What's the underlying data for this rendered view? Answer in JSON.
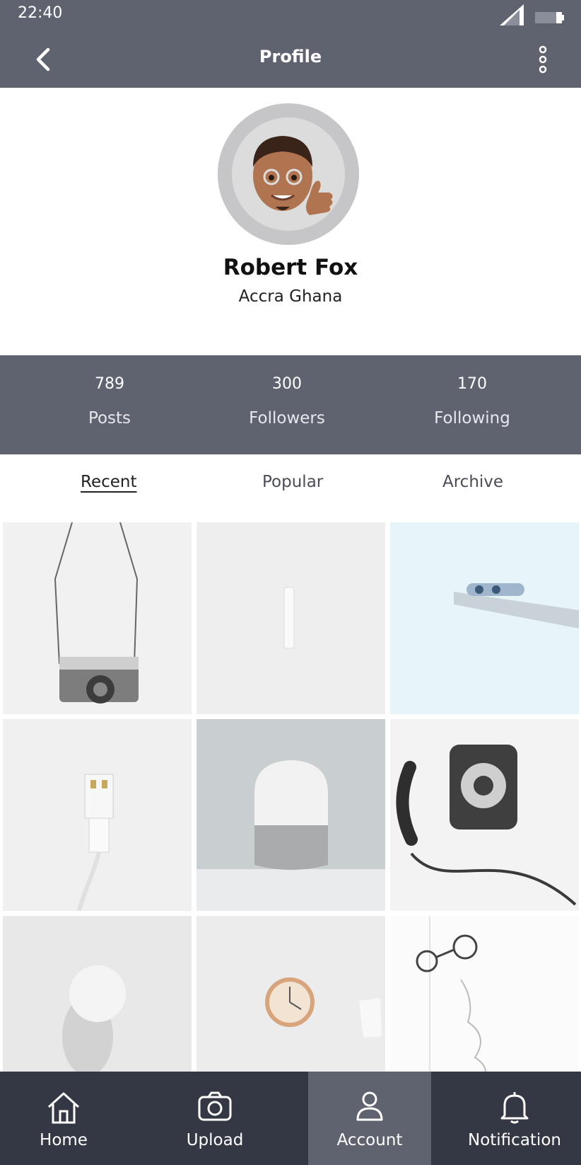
{
  "status_bar": {
    "time": "22:40",
    "signal_icon": "signal-icon",
    "battery_icon": "battery-icon"
  },
  "app_bar": {
    "title": "Profile",
    "back_icon": "chevron-left-icon",
    "more_icon": "more-vertical-icon"
  },
  "profile": {
    "name": "Robert Fox",
    "location": "Accra Ghana"
  },
  "stats": [
    {
      "value": "789",
      "label": "Posts"
    },
    {
      "value": "300",
      "label": "Followers"
    },
    {
      "value": "170",
      "label": "Following"
    }
  ],
  "tabs": [
    {
      "label": "Recent",
      "active": true
    },
    {
      "label": "Popular",
      "active": false
    },
    {
      "label": "Archive",
      "active": false
    }
  ],
  "bottom_nav": [
    {
      "label": "Home",
      "icon": "home-icon",
      "active": false
    },
    {
      "label": "Upload",
      "icon": "camera-icon",
      "active": false
    },
    {
      "label": "Account",
      "icon": "user-icon",
      "active": true
    },
    {
      "label": "Notification",
      "icon": "bell-icon",
      "active": false
    }
  ],
  "colors": {
    "header": "#5f6370",
    "bottom_nav": "#343844",
    "active_nav": "#5f6370"
  }
}
